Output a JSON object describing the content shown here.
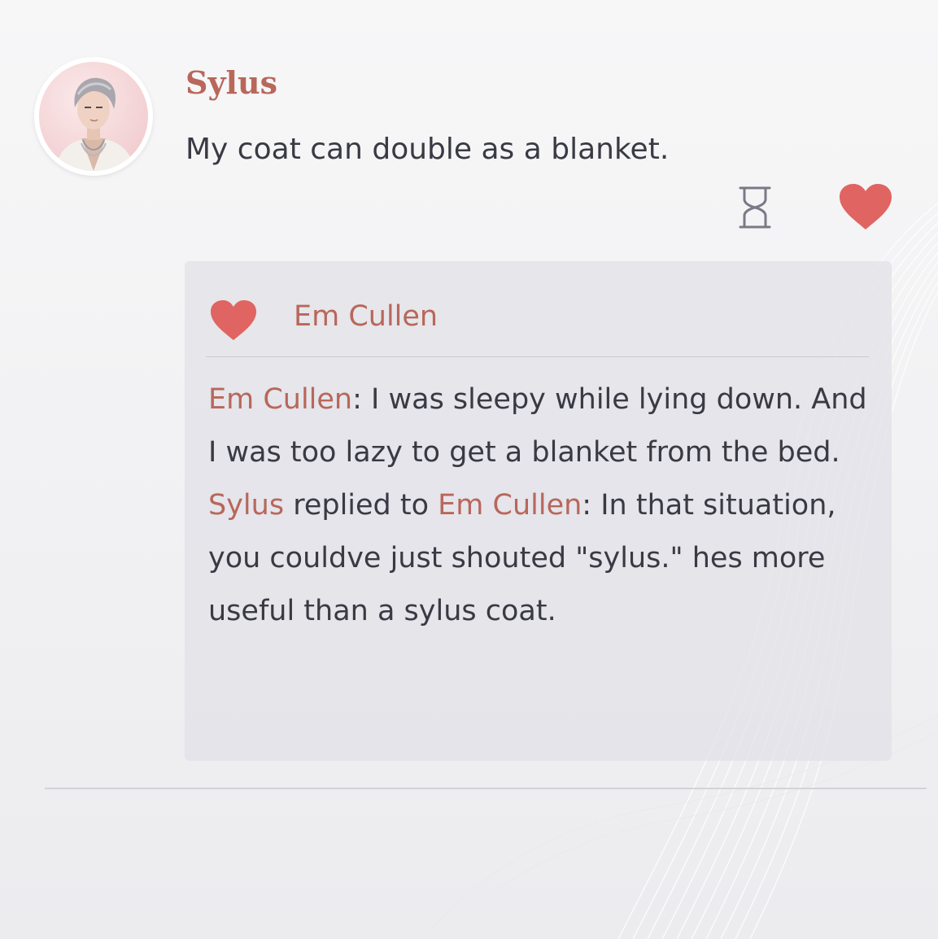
{
  "post": {
    "author": "Sylus",
    "text": "My coat can double as a blanket.",
    "icons": {
      "avatar": "avatar-portrait",
      "hourglass": "hourglass-icon",
      "like": "heart-icon"
    }
  },
  "likes": {
    "names": [
      "Em Cullen"
    ]
  },
  "comments": [
    {
      "author": "Em Cullen",
      "separator": ": ",
      "text": "I was sleepy while lying down. And I was too lazy to get a blanket from the bed."
    },
    {
      "author": "Sylus",
      "reply_word": " replied to ",
      "reply_to": "Em Cullen",
      "separator": ": ",
      "text": "In that situation, you couldve just shouted \"sylus.\" hes more useful than a sylus coat."
    }
  ],
  "colors": {
    "name": "#b8675a",
    "heart": "#e06461",
    "text": "#3a3a44",
    "comment_bg": "#e2e2e8"
  }
}
